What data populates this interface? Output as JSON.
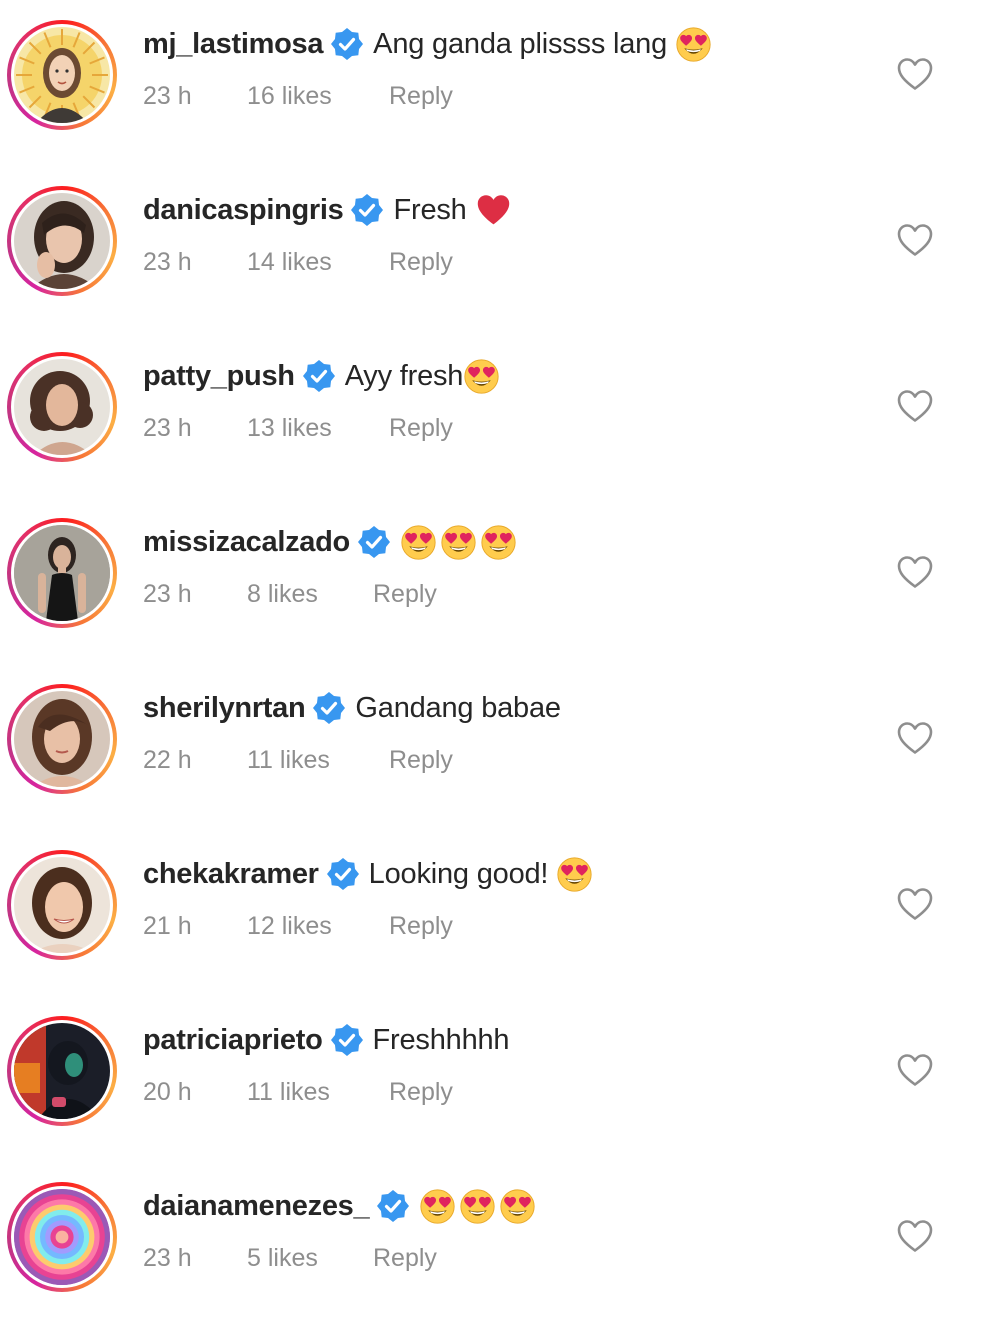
{
  "comments": [
    {
      "username": "mj_lastimosa",
      "text": "Ang ganda plissss lang",
      "emoji": [
        "heart-eyes"
      ],
      "time": "23 h",
      "likes": "16 likes",
      "reply": "Reply",
      "avatar": "portrait-illustration"
    },
    {
      "username": "danicaspingris",
      "text": "Fresh",
      "emoji": [
        "red-heart"
      ],
      "time": "23 h",
      "likes": "14 likes",
      "reply": "Reply",
      "avatar": "woman-dark-hair"
    },
    {
      "username": "patty_push",
      "text": "Ayy fresh",
      "emoji": [
        "heart-eyes"
      ],
      "time": "23 h",
      "likes": "13 likes",
      "reply": "Reply",
      "avatar": "woman-curly-hair"
    },
    {
      "username": "missizacalzado",
      "text": "",
      "emoji": [
        "heart-eyes",
        "heart-eyes",
        "heart-eyes"
      ],
      "time": "23 h",
      "likes": "8 likes",
      "reply": "Reply",
      "avatar": "woman-black-dress"
    },
    {
      "username": "sherilynrtan",
      "text": "Gandang babae",
      "emoji": [],
      "time": "22 h",
      "likes": "11 likes",
      "reply": "Reply",
      "avatar": "woman-brunette"
    },
    {
      "username": "chekakramer",
      "text": "Looking good!",
      "emoji": [
        "heart-eyes"
      ],
      "time": "21 h",
      "likes": "12 likes",
      "reply": "Reply",
      "avatar": "woman-smiling"
    },
    {
      "username": "patriciaprieto",
      "text": "Freshhhhh",
      "emoji": [],
      "time": "20 h",
      "likes": "11 likes",
      "reply": "Reply",
      "avatar": "dark-silhouette-neon"
    },
    {
      "username": "daianamenezes_",
      "text": "",
      "emoji": [
        "heart-eyes",
        "heart-eyes",
        "heart-eyes"
      ],
      "time": "23 h",
      "likes": "5 likes",
      "reply": "Reply",
      "avatar": "rainbow-rings"
    }
  ],
  "colors": {
    "username": "#262626",
    "meta": "#8e8e8e",
    "verified": "#3897f0",
    "heart_outline": "#8e8e8e",
    "story_ring": [
      "#d6249f",
      "#fd1d1d",
      "#fcaf45"
    ]
  },
  "icons": {
    "verified": "verified-badge-icon",
    "like": "heart-outline-icon"
  }
}
